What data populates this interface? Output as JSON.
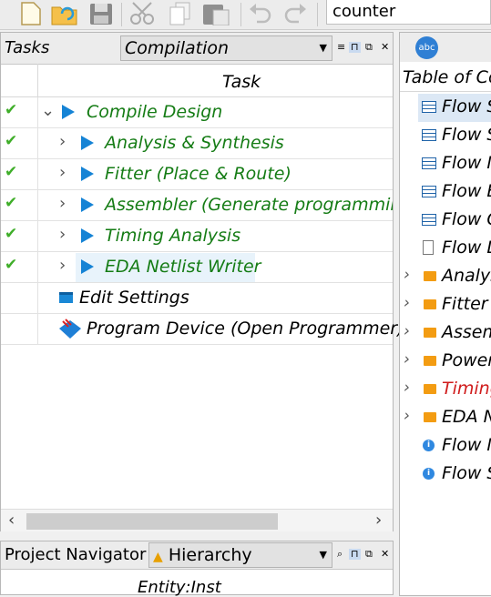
{
  "toolbar": {
    "icons": [
      "new-file-icon",
      "open-file-icon",
      "save-icon",
      "cut-icon",
      "copy-icon",
      "paste-icon",
      "undo-icon",
      "redo-icon"
    ],
    "project_value": "counter"
  },
  "tasks_panel": {
    "title": "Tasks",
    "flow_select": "Compilation",
    "column_header": "Task",
    "rows": [
      {
        "label": "Compile Design",
        "checked": true
      },
      {
        "label": "Analysis & Synthesis",
        "checked": true
      },
      {
        "label": "Fitter (Place & Route)",
        "checked": true
      },
      {
        "label": "Assembler (Generate programming",
        "checked": true
      },
      {
        "label": "Timing Analysis",
        "checked": true
      },
      {
        "label": "EDA Netlist Writer",
        "checked": true
      },
      {
        "label": "Edit Settings",
        "checked": false
      },
      {
        "label": "Program Device (Open Programmer)",
        "checked": false
      }
    ]
  },
  "navigator_panel": {
    "title": "Project Navigator",
    "view_select": "Hierarchy",
    "column_header": "Entity:Inst"
  },
  "report_panel": {
    "icon_text": "abc",
    "toc_header": "Table of Co",
    "items": [
      {
        "label": "Flow S"
      },
      {
        "label": "Flow S"
      },
      {
        "label": "Flow N"
      },
      {
        "label": "Flow E"
      },
      {
        "label": "Flow O"
      },
      {
        "label": "Flow L"
      },
      {
        "label": "Analys"
      },
      {
        "label": "Fitter"
      },
      {
        "label": "Assem"
      },
      {
        "label": "Power"
      },
      {
        "label": "Timing"
      },
      {
        "label": "EDA N"
      },
      {
        "label": "Flow M"
      },
      {
        "label": "Flow S"
      }
    ]
  },
  "colors": {
    "success": "#3fae29",
    "task_text": "#157c15",
    "play": "#1583d5",
    "warning_text": "#d01c1c",
    "folder": "#f39c12"
  }
}
